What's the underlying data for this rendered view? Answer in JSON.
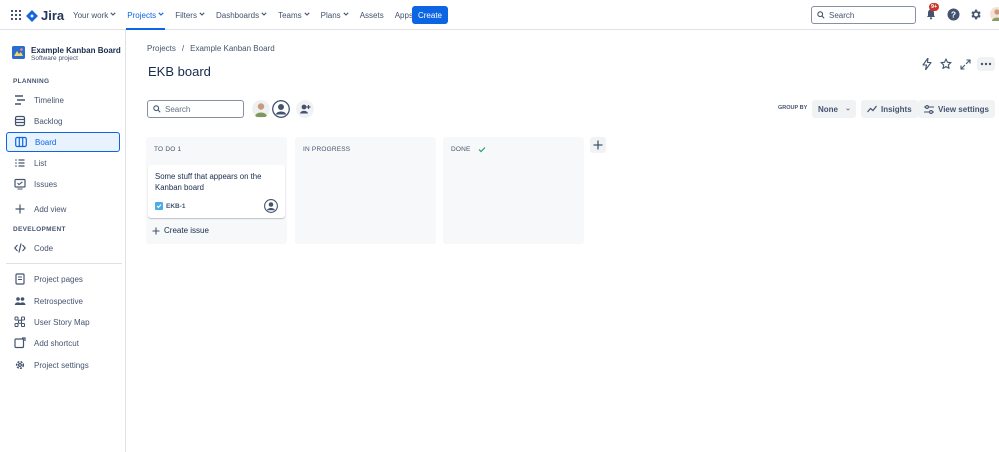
{
  "nav": {
    "logo": "Jira",
    "items": [
      {
        "label": "Your work",
        "active": false
      },
      {
        "label": "Projects",
        "active": true
      },
      {
        "label": "Filters",
        "active": false
      },
      {
        "label": "Dashboards",
        "active": false
      },
      {
        "label": "Teams",
        "active": false
      },
      {
        "label": "Plans",
        "active": false
      },
      {
        "label": "Assets",
        "active": false,
        "nochev": true
      },
      {
        "label": "Apps",
        "active": false
      }
    ],
    "create_label": "Create",
    "search_placeholder": "Search",
    "notifications_badge": "9+"
  },
  "sidebar": {
    "project_name": "Example Kanban Board",
    "project_type": "Software project",
    "planning_header": "PLANNING",
    "development_header": "DEVELOPMENT",
    "planning_items": [
      {
        "label": "Timeline",
        "icon": "timeline-icon"
      },
      {
        "label": "Backlog",
        "icon": "backlog-icon"
      },
      {
        "label": "Board",
        "icon": "board-icon",
        "active": true
      },
      {
        "label": "List",
        "icon": "list-icon"
      },
      {
        "label": "Issues",
        "icon": "issues-icon"
      },
      {
        "label": "Add view",
        "icon": "plus-icon"
      }
    ],
    "development_items": [
      {
        "label": "Code",
        "icon": "code-icon"
      }
    ],
    "bottom_items": [
      {
        "label": "Project pages",
        "icon": "page-icon"
      },
      {
        "label": "Retrospective",
        "icon": "people-icon"
      },
      {
        "label": "User Story Map",
        "icon": "story-map-icon"
      },
      {
        "label": "Add shortcut",
        "icon": "add-shortcut-icon"
      },
      {
        "label": "Project settings",
        "icon": "gear-icon"
      }
    ]
  },
  "main": {
    "breadcrumb": [
      "Projects",
      "Example Kanban Board"
    ],
    "breadcrumb_sep": "/",
    "title": "EKB board",
    "search_placeholder": "Search",
    "group_by_label": "GROUP BY",
    "group_by_value": "None",
    "insights_label": "Insights",
    "view_settings_label": "View settings"
  },
  "columns": [
    {
      "name": "TO DO 1"
    },
    {
      "name": "IN PROGRESS"
    },
    {
      "name": "DONE"
    }
  ],
  "card": {
    "title": "Some stuff that appears on the Kanban board",
    "key": "EKB-1"
  },
  "create_issue_label": "Create issue",
  "colors": {
    "accent": "#0c66e4",
    "badge": "#c9372c"
  }
}
